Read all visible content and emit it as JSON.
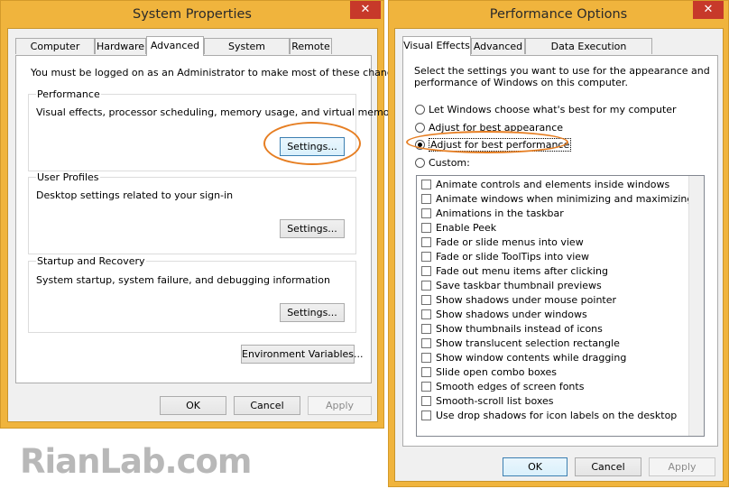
{
  "system_properties": {
    "title": "System Properties",
    "close_label": "✕",
    "tabs": [
      "Computer Name",
      "Hardware",
      "Advanced",
      "System Protection",
      "Remote"
    ],
    "active_tab": "Advanced",
    "admin_note": "You must be logged on as an Administrator to make most of these changes.",
    "performance": {
      "title": "Performance",
      "description": "Visual effects, processor scheduling, memory usage, and virtual memory",
      "button": "Settings..."
    },
    "user_profiles": {
      "title": "User Profiles",
      "description": "Desktop settings related to your sign-in",
      "button": "Settings..."
    },
    "startup_recovery": {
      "title": "Startup and Recovery",
      "description": "System startup, system failure, and debugging information",
      "button": "Settings..."
    },
    "env_button": "Environment Variables...",
    "ok": "OK",
    "cancel": "Cancel",
    "apply": "Apply"
  },
  "performance_options": {
    "title": "Performance Options",
    "close_label": "✕",
    "tabs": [
      "Visual Effects",
      "Advanced",
      "Data Execution Prevention"
    ],
    "active_tab": "Visual Effects",
    "intro_line1": "Select the settings you want to use for the appearance and",
    "intro_line2": "performance of Windows on this computer.",
    "radios": [
      {
        "label": "Let Windows choose what's best for my computer",
        "selected": false
      },
      {
        "label": "Adjust for best appearance",
        "selected": false
      },
      {
        "label": "Adjust for best performance",
        "selected": true
      },
      {
        "label": "Custom:",
        "selected": false
      }
    ],
    "checkboxes": [
      "Animate controls and elements inside windows",
      "Animate windows when minimizing and maximizing",
      "Animations in the taskbar",
      "Enable Peek",
      "Fade or slide menus into view",
      "Fade or slide ToolTips into view",
      "Fade out menu items after clicking",
      "Save taskbar thumbnail previews",
      "Show shadows under mouse pointer",
      "Show shadows under windows",
      "Show thumbnails instead of icons",
      "Show translucent selection rectangle",
      "Show window contents while dragging",
      "Slide open combo boxes",
      "Smooth edges of screen fonts",
      "Smooth-scroll list boxes",
      "Use drop shadows for icon labels on the desktop"
    ],
    "ok": "OK",
    "cancel": "Cancel",
    "apply": "Apply"
  },
  "watermark": "RianLab.com",
  "colors": {
    "frame": "#f0b43d",
    "close": "#c7392a",
    "highlight_ellipse": "#e67e22"
  }
}
